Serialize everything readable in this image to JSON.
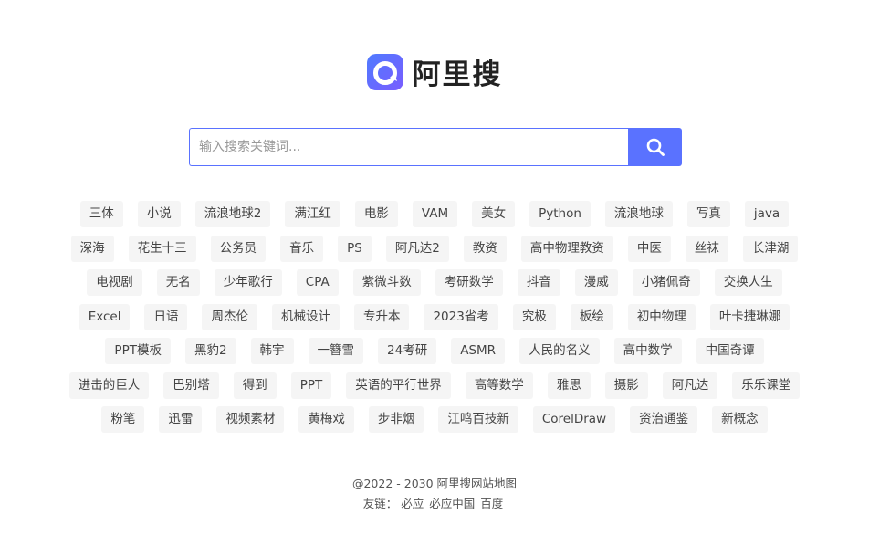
{
  "brand": {
    "name": "阿里搜",
    "accent": "#5a72ff"
  },
  "search": {
    "placeholder": "输入搜索关键词...",
    "value": "",
    "button_icon": "search-icon"
  },
  "tags": [
    [
      "三体",
      "小说",
      "流浪地球2",
      "满江红",
      "电影",
      "VAM",
      "美女",
      "Python",
      "流浪地球",
      "写真",
      "java"
    ],
    [
      "深海",
      "花生十三",
      "公务员",
      "音乐",
      "PS",
      "阿凡达2",
      "教资",
      "高中物理教资",
      "中医",
      "丝袜",
      "长津湖"
    ],
    [
      "电视剧",
      "无名",
      "少年歌行",
      "CPA",
      "紫微斗数",
      "考研数学",
      "抖音",
      "漫威",
      "小猪佩奇",
      "交换人生"
    ],
    [
      "Excel",
      "日语",
      "周杰伦",
      "机械设计",
      "专升本",
      "2023省考",
      "究极",
      "板绘",
      "初中物理",
      "叶卡捷琳娜"
    ],
    [
      "PPT模板",
      "黑豹2",
      "韩宇",
      "一簪雪",
      "24考研",
      "ASMR",
      "人民的名义",
      "高中数学",
      "中国奇谭"
    ],
    [
      "进击的巨人",
      "巴别塔",
      "得到",
      "PPT",
      "英语的平行世界",
      "高等数学",
      "雅思",
      "摄影",
      "阿凡达",
      "乐乐课堂"
    ],
    [
      "粉笔",
      "迅雷",
      "视频素材",
      "黄梅戏",
      "步非烟",
      "江鸣百技新",
      "CorelDraw",
      "资治通鉴",
      "新概念"
    ]
  ],
  "footer": {
    "copyright": "@2022 - 2030 阿里搜网站地图",
    "links_label": "友链：",
    "links": [
      "必应",
      "必应中国",
      "百度"
    ]
  }
}
